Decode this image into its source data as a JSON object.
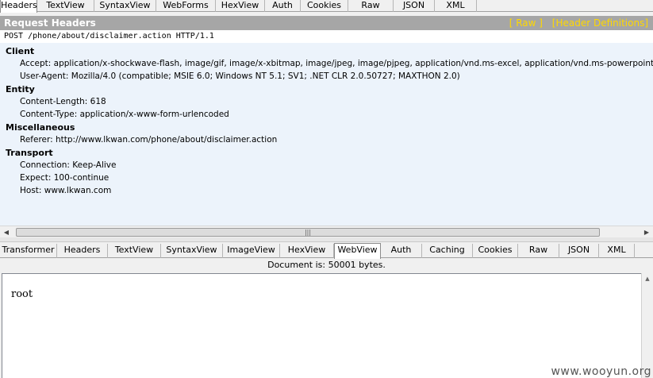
{
  "top_tabs": [
    "Headers",
    "TextView",
    "SyntaxView",
    "WebForms",
    "HexView",
    "Auth",
    "Cookies",
    "Raw",
    "JSON",
    "XML"
  ],
  "top_active": "Headers",
  "request": {
    "title": "Request Headers",
    "link_raw": "[ Raw ]",
    "link_defs": "[Header Definitions]",
    "request_line": "POST /phone/about/disclaimer.action HTTP/1.1",
    "groups": [
      {
        "name": "Client",
        "headers": [
          "Accept: application/x-shockwave-flash, image/gif, image/x-xbitmap, image/jpeg, image/pjpeg, application/vnd.ms-excel, application/vnd.ms-powerpoint, application/m",
          "User-Agent: Mozilla/4.0 (compatible; MSIE 6.0; Windows NT 5.1; SV1; .NET CLR 2.0.50727; MAXTHON 2.0)"
        ]
      },
      {
        "name": "Entity",
        "headers": [
          "Content-Length: 618",
          "Content-Type: application/x-www-form-urlencoded"
        ]
      },
      {
        "name": "Miscellaneous",
        "headers": [
          "Referer: http://www.lkwan.com/phone/about/disclaimer.action"
        ]
      },
      {
        "name": "Transport",
        "headers": [
          "Connection: Keep-Alive",
          "Expect: 100-continue",
          "Host: www.lkwan.com"
        ]
      }
    ]
  },
  "bottom_tabs": [
    "Transformer",
    "Headers",
    "TextView",
    "SyntaxView",
    "ImageView",
    "HexView",
    "WebView",
    "Auth",
    "Caching",
    "Cookies",
    "Raw",
    "JSON",
    "XML"
  ],
  "bottom_active": "WebView",
  "doc_info": "Document is: 50001 bytes.",
  "web_content": "root",
  "watermark": "www.wooyun.org",
  "icons": {
    "scroll_left": "arrow-left-icon",
    "scroll_right": "arrow-right-icon",
    "scroll_up": "arrow-up-icon",
    "grip": "grip-icon"
  },
  "colors": {
    "title_bar": "#a6a6a6",
    "link": "#ffd800",
    "panel_bg": "#ecf3fb"
  }
}
